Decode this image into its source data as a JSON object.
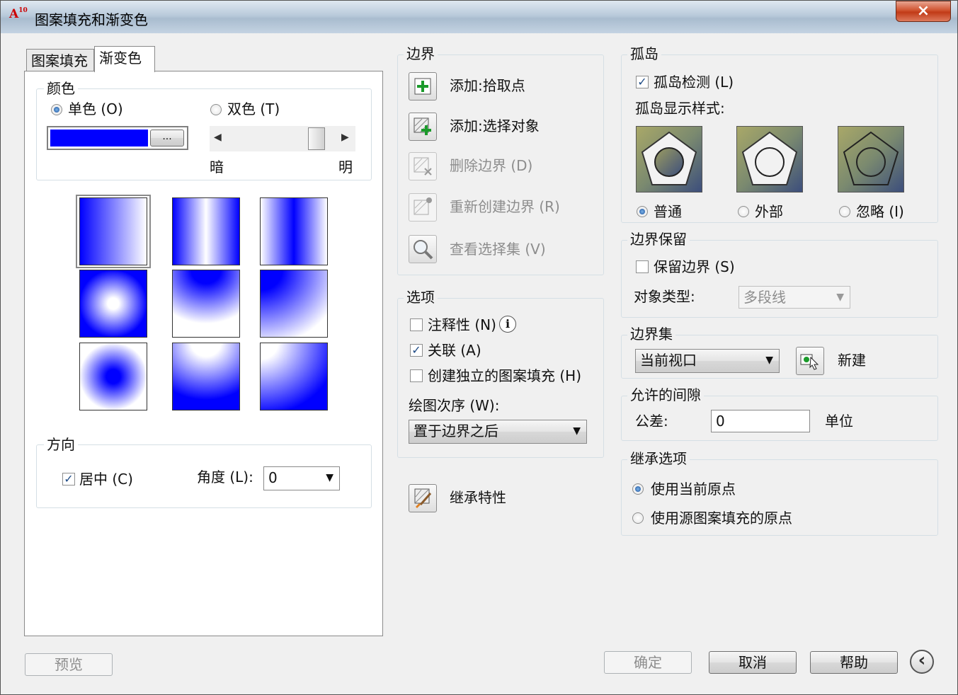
{
  "window": {
    "title": "图案填充和渐变色",
    "app_icon": "A10",
    "close_label": "×"
  },
  "tabs": [
    {
      "label": "图案填充"
    },
    {
      "label": "渐变色"
    }
  ],
  "gradient": {
    "color_group_label": "颜色",
    "one_color_label": "单色 (O)",
    "two_color_label": "双色 (T)",
    "one_color_selected": true,
    "color_swatch": "#0000ff",
    "browse_button_label": "...",
    "shade_dark_label": "暗",
    "shade_light_label": "明",
    "shade_value": 0.85,
    "pattern_colors": {
      "primary": "#0000ff",
      "secondary": "#ffffff"
    },
    "orientation_group_label": "方向",
    "centered_label": "居中 (C)",
    "centered_checked": true,
    "angle_label": "角度 (L):",
    "angle_value": "0"
  },
  "boundaries": {
    "group_label": "边界",
    "add_pick_points_label": "添加:拾取点",
    "add_select_objects_label": "添加:选择对象",
    "remove_boundaries_label": "删除边界 (D)",
    "recreate_boundary_label": "重新创建边界 (R)",
    "view_selections_label": "查看选择集 (V)"
  },
  "options": {
    "group_label": "选项",
    "annotative_label": "注释性 (N)",
    "annotative_checked": false,
    "associative_label": "关联 (A)",
    "associative_checked": true,
    "separate_hatches_label": "创建独立的图案填充 (H)",
    "separate_hatches_checked": false,
    "draw_order_label": "绘图次序 (W):",
    "draw_order_value": "置于边界之后",
    "inherit_label": "继承特性"
  },
  "islands": {
    "group_label": "孤岛",
    "detection_label": "孤岛检测 (L)",
    "detection_checked": true,
    "display_style_label": "孤岛显示样式:",
    "normal_label": "普通",
    "outer_label": "外部",
    "ignore_label": "忽略 (I)",
    "selected_style": "normal"
  },
  "boundary_retention": {
    "group_label": "边界保留",
    "retain_label": "保留边界 (S)",
    "retain_checked": false,
    "object_type_label": "对象类型:",
    "object_type_value": "多段线"
  },
  "boundary_set": {
    "group_label": "边界集",
    "value": "当前视口",
    "new_label": "新建"
  },
  "gap_tolerance": {
    "group_label": "允许的间隙",
    "tolerance_label": "公差:",
    "tolerance_value": "0",
    "units_label": "单位"
  },
  "inherit_options": {
    "group_label": "继承选项",
    "use_current_origin_label": "使用当前原点",
    "use_source_origin_label": "使用源图案填充的原点",
    "selected": "current"
  },
  "footer": {
    "preview_label": "预览",
    "ok_label": "确定",
    "cancel_label": "取消",
    "help_label": "帮助",
    "more_label": "‹"
  }
}
